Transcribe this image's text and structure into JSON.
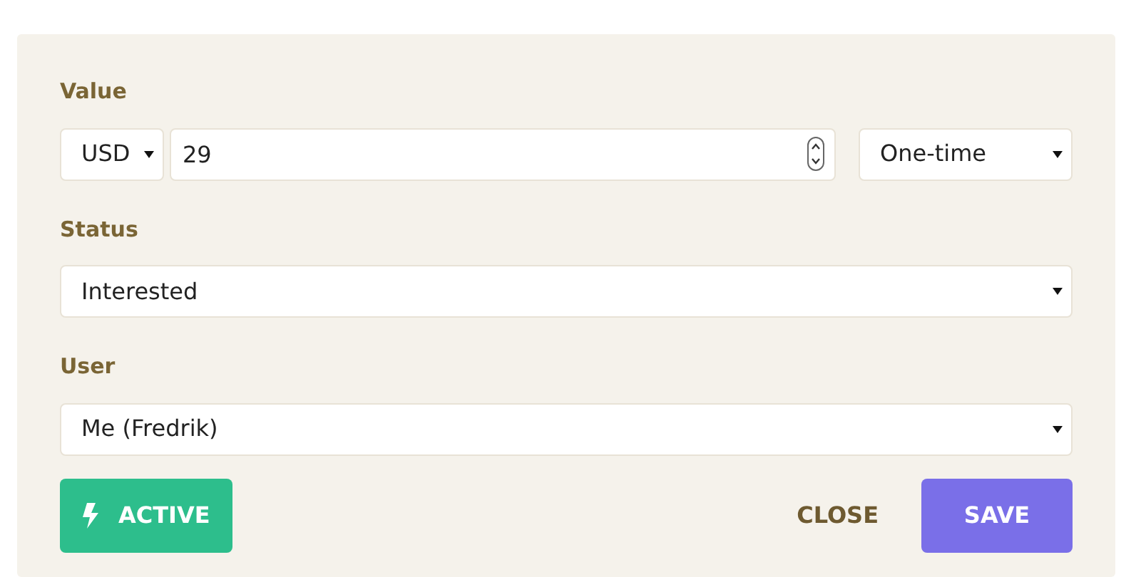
{
  "fields": [
    {
      "label": "Value",
      "kind": "value",
      "currency": "USD",
      "amount": "29",
      "frequency": "One-time"
    },
    {
      "label": "Status",
      "kind": "select",
      "value": "Interested"
    },
    {
      "label": "User",
      "kind": "select",
      "value": "Me (Fredrik)"
    }
  ],
  "buttons": [
    {
      "label": "ACTIVE",
      "kind": "toggle"
    },
    {
      "label": "CLOSE",
      "kind": "link"
    },
    {
      "label": "SAVE",
      "kind": "primary"
    }
  ]
}
